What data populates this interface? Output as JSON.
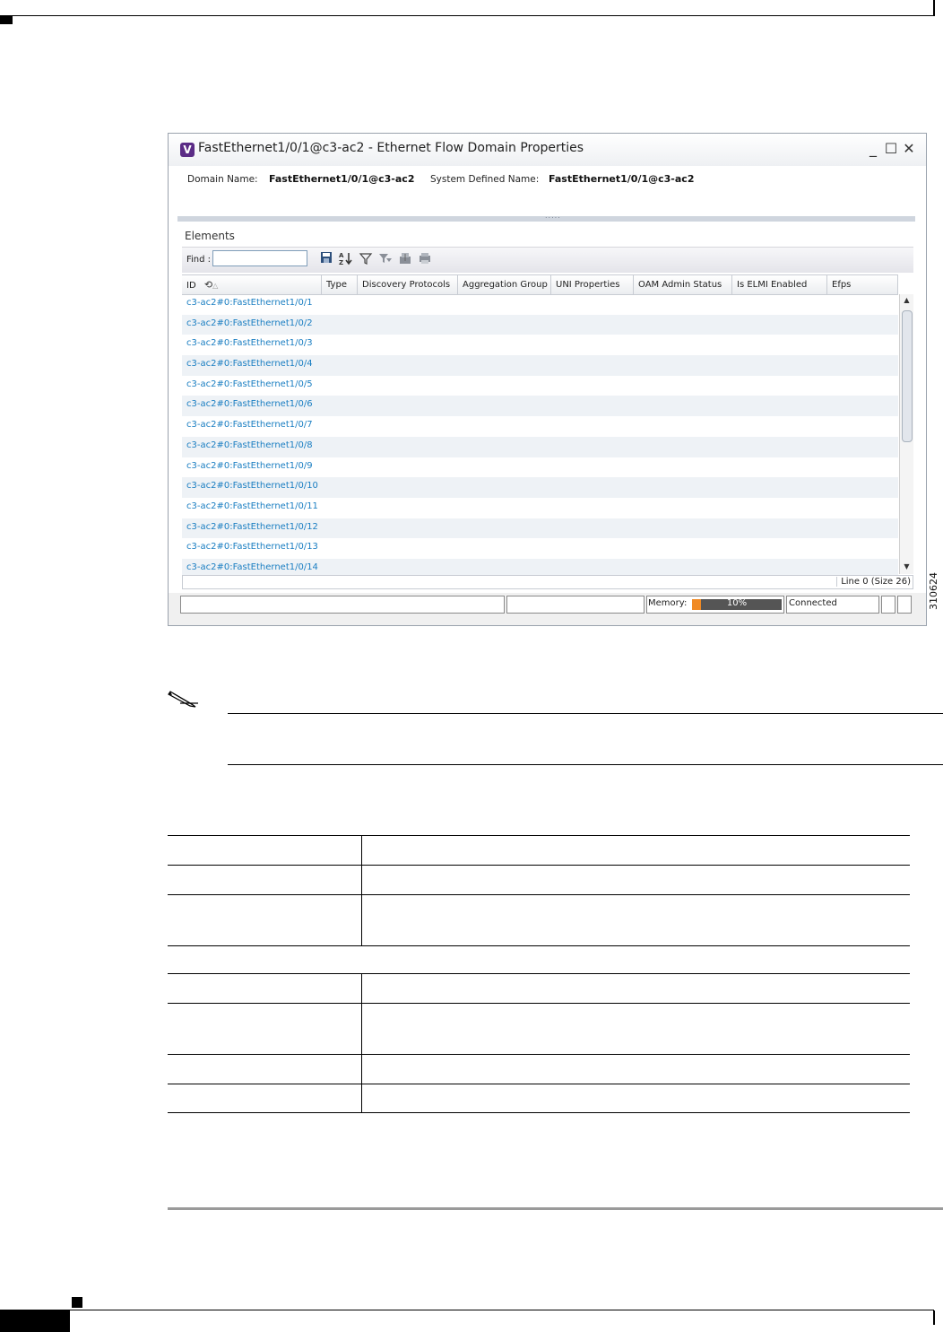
{
  "window": {
    "icon_letter": "V",
    "title": "FastEthernet1/0/1@c3-ac2 - Ethernet Flow Domain Properties",
    "minimize": "_",
    "maximize": "☐",
    "close": "✕"
  },
  "domain": {
    "domain_name_label": "Domain Name:",
    "domain_name_value": "FastEthernet1/0/1@c3-ac2",
    "system_defined_label": "System Defined Name:",
    "system_defined_value": "FastEthernet1/0/1@c3-ac2"
  },
  "splitter_dots": ".....",
  "elements": {
    "label": "Elements",
    "find_label": "Find :",
    "find_value": "",
    "columns": [
      "ID",
      "Type",
      "Discovery Protocols",
      "Aggregation Group",
      "UNI Properties",
      "OAM Admin Status",
      "Is ELMI Enabled",
      "Efps"
    ],
    "rows": [
      "c3-ac2#0:FastEthernet1/0/1",
      "c3-ac2#0:FastEthernet1/0/2",
      "c3-ac2#0:FastEthernet1/0/3",
      "c3-ac2#0:FastEthernet1/0/4",
      "c3-ac2#0:FastEthernet1/0/5",
      "c3-ac2#0:FastEthernet1/0/6",
      "c3-ac2#0:FastEthernet1/0/7",
      "c3-ac2#0:FastEthernet1/0/8",
      "c3-ac2#0:FastEthernet1/0/9",
      "c3-ac2#0:FastEthernet1/0/10",
      "c3-ac2#0:FastEthernet1/0/11",
      "c3-ac2#0:FastEthernet1/0/12",
      "c3-ac2#0:FastEthernet1/0/13",
      "c3-ac2#0:FastEthernet1/0/14"
    ],
    "line_count": "Line 0 (Size 26)"
  },
  "status": {
    "memory_label": "Memory:",
    "memory_percent_text": "10%",
    "memory_fraction": 0.1,
    "connection": "Connected"
  },
  "figure_id": "310624",
  "colors": {
    "link": "#1a7ec2",
    "memory_fill": "#f08a24",
    "app_icon": "#5b2c86"
  }
}
